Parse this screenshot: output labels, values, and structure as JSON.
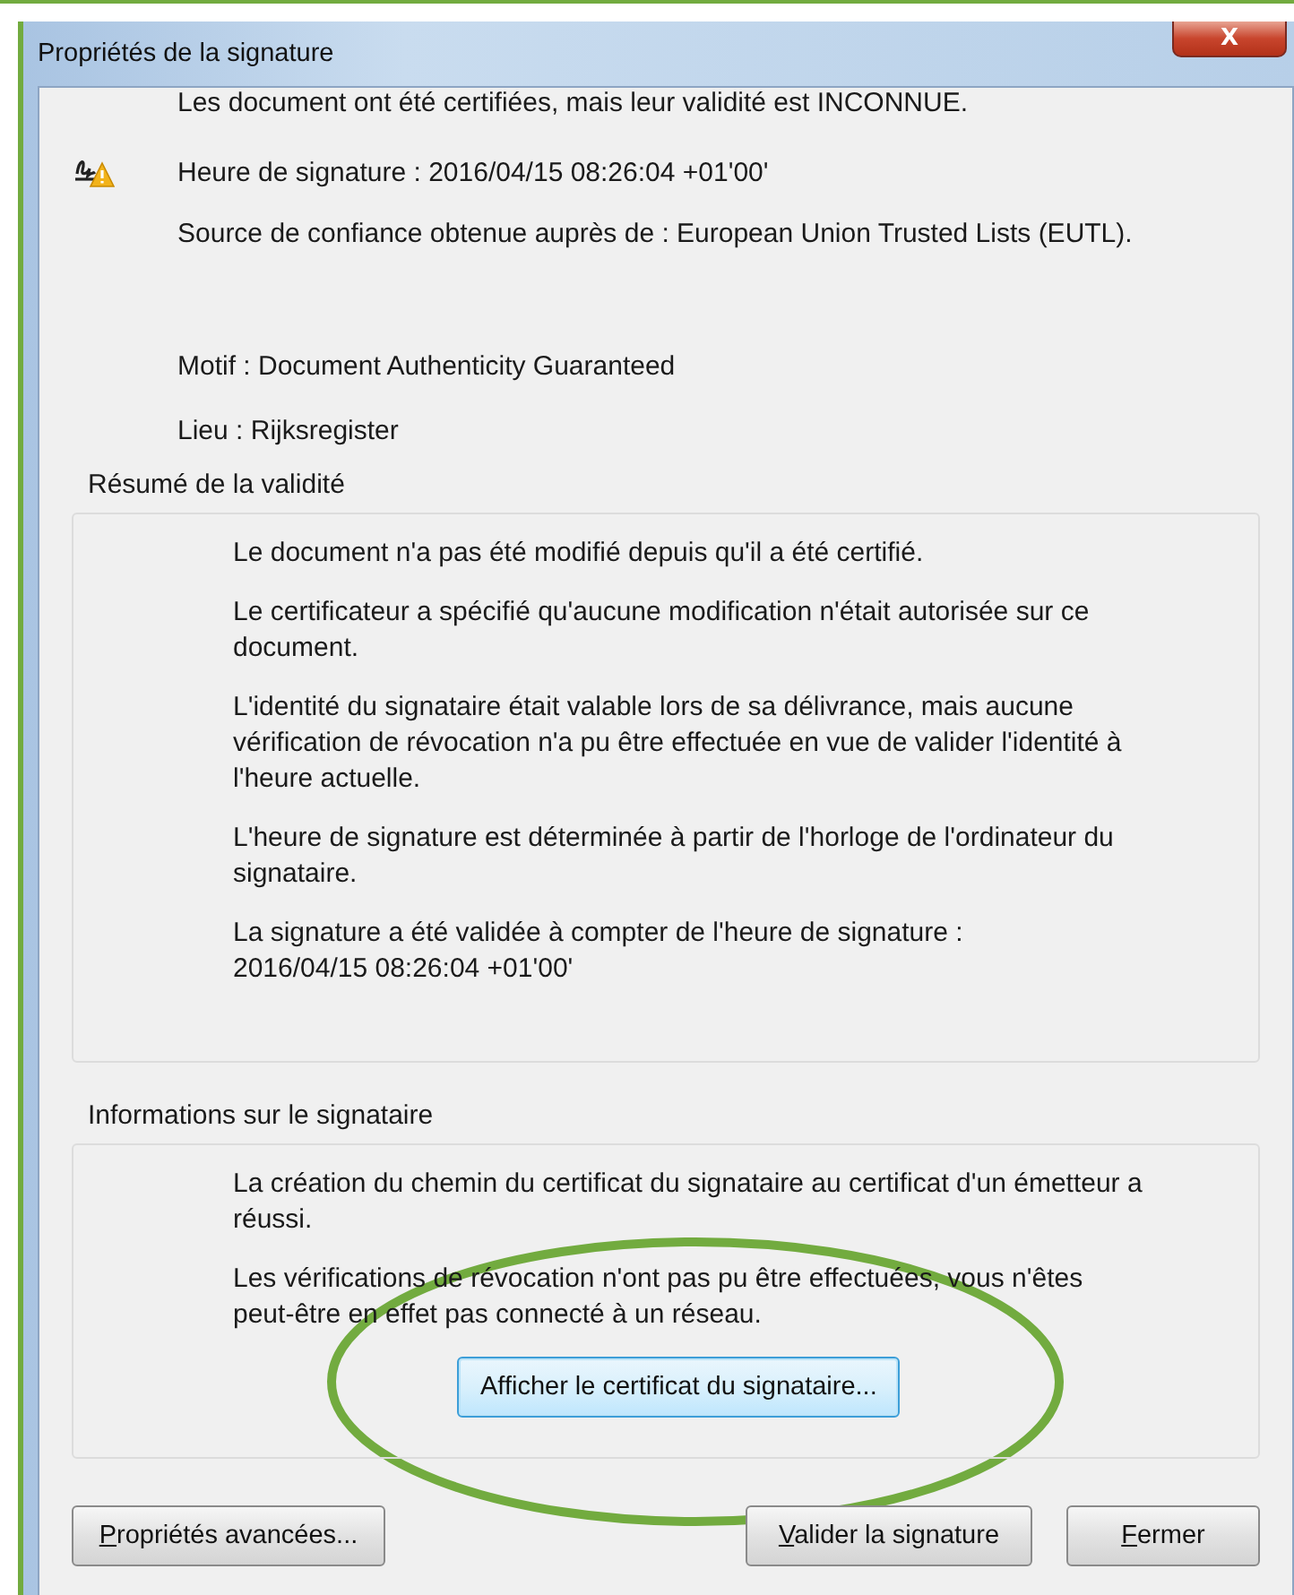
{
  "window": {
    "title": "Propriétés de la signature",
    "close_label": "X"
  },
  "summary": {
    "status": "Les document ont été certifiées, mais leur validité est INCONNUE.",
    "lines": [
      {
        "text": "Heure de signature :  2016/04/15 08:26:04 +01'00'"
      },
      {
        "text": "Source de confiance obtenue auprès de : European Union Trusted Lists (EUTL)."
      },
      {
        "text": "Motif :  Document Authenticity Guaranteed"
      },
      {
        "text": "Lieu :  Rijksregister"
      }
    ]
  },
  "validity_group": {
    "title": "Résumé de la validité",
    "paragraphs": [
      "Le document n'a pas été modifié depuis qu'il a été certifié.",
      "Le certificateur a spécifié qu'aucune modification n'était autorisée sur ce document.",
      "L'identité du signataire était valable lors de sa délivrance, mais aucune vérification de révocation n'a pu être effectuée en vue de valider l'identité à l'heure actuelle.",
      "L'heure de signature est déterminée à partir de l'horloge de l'ordinateur du signataire.",
      "La signature a été validée à compter de l'heure de signature :\n2016/04/15 08:26:04 +01'00'"
    ]
  },
  "signer_group": {
    "title": "Informations sur le signataire",
    "paragraphs": [
      "La création du chemin du certificat du signataire au certificat d'un émetteur a réussi.",
      "Les vérifications de révocation n'ont pas pu être effectuées, vous n'êtes peut-être en effet pas connecté à un réseau."
    ],
    "button": {
      "label": "Afficher le certificat du signataire...",
      "focused": true
    }
  },
  "buttons": [
    {
      "label": "Propriétés avancées...",
      "mnemonic": true
    },
    {
      "label": "Valider la signature",
      "mnemonic": true
    },
    {
      "label": "Fermer",
      "mnemonic": true
    }
  ],
  "annotation": {
    "kind": "ellipse",
    "color": "#72ab3f"
  }
}
